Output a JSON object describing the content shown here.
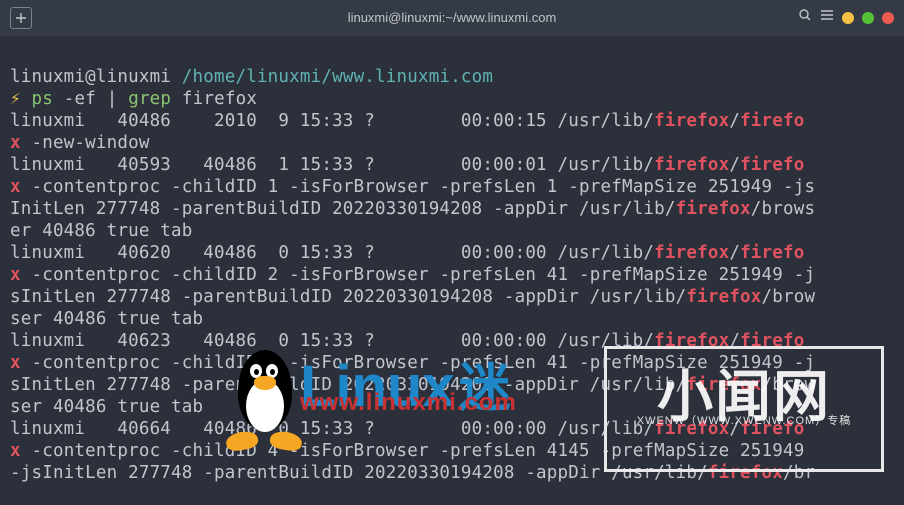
{
  "window": {
    "title": "linuxmi@linuxmi:~/www.linuxmi.com"
  },
  "prompt": {
    "user_host": "linuxmi@linuxmi",
    "cwd": "/home/linuxmi/www.linuxmi.com",
    "symbol": "⚡",
    "cmd1": "ps",
    "cmd1_args": "-ef",
    "pipe": "|",
    "cmd2": "grep",
    "cmd2_args": "firefox"
  },
  "hl": {
    "firefox": "firefox",
    "x": "x"
  },
  "lines": {
    "l1a": "linuxmi   40486    2010  9 15:33 ?        00:00:15 /usr/lib/",
    "l1b": "/",
    "l1c": "firefo",
    "l2": " -new-window",
    "l3a": "linuxmi   40593   40486  1 15:33 ?        00:00:01 /usr/lib/",
    "l3b": "/",
    "l3c": "firefo",
    "l4": " -contentproc -childID 1 -isForBrowser -prefsLen 1 -prefMapSize 251949 -js",
    "l5a": "InitLen 277748 -parentBuildID 20220330194208 -appDir /usr/lib/",
    "l5b": "/brows",
    "l6": "er 40486 true tab",
    "l7a": "linuxmi   40620   40486  0 15:33 ?        00:00:00 /usr/lib/",
    "l7b": "/",
    "l7c": "firefo",
    "l8": " -contentproc -childID 2 -isForBrowser -prefsLen 41 -prefMapSize 251949 -j",
    "l9a": "sInitLen 277748 -parentBuildID 20220330194208 -appDir /usr/lib/",
    "l9b": "/brow",
    "l10": "ser 40486 true tab",
    "l11a": "linuxmi   40623   40486  0 15:33 ?        00:00:00 /usr/lib/",
    "l11b": "/",
    "l11c": "firefo",
    "l12": " -contentproc -childID 3 -isForBrowser -prefsLen 41 -prefMapSize 251949 -j",
    "l13a": "sInitLen 277748 -parentBuildID 20220330194208 -appDir /usr/lib/",
    "l13b": "/brow",
    "l14": "ser 40486 true tab",
    "l15a": "linuxmi   40664   40486  0 15:33 ?        00:00:00 /usr/lib/",
    "l15b": "/",
    "l15c": "firefo",
    "l16": " -contentproc -childID 4 -isForBrowser -prefsLen 4145 -prefMapSize 251949",
    "l17a": "-jsInitLen 277748 -parentBuildID 20220330194208 -appDir /usr/lib/",
    "l17b": "/br"
  },
  "watermark1": {
    "big": "Linux",
    "mi": "迷",
    "url": "www.linuxmi.com"
  },
  "watermark2": {
    "cn": "小闻网",
    "sub": "XWENW（WWW.XWENW.COM）专稿"
  }
}
